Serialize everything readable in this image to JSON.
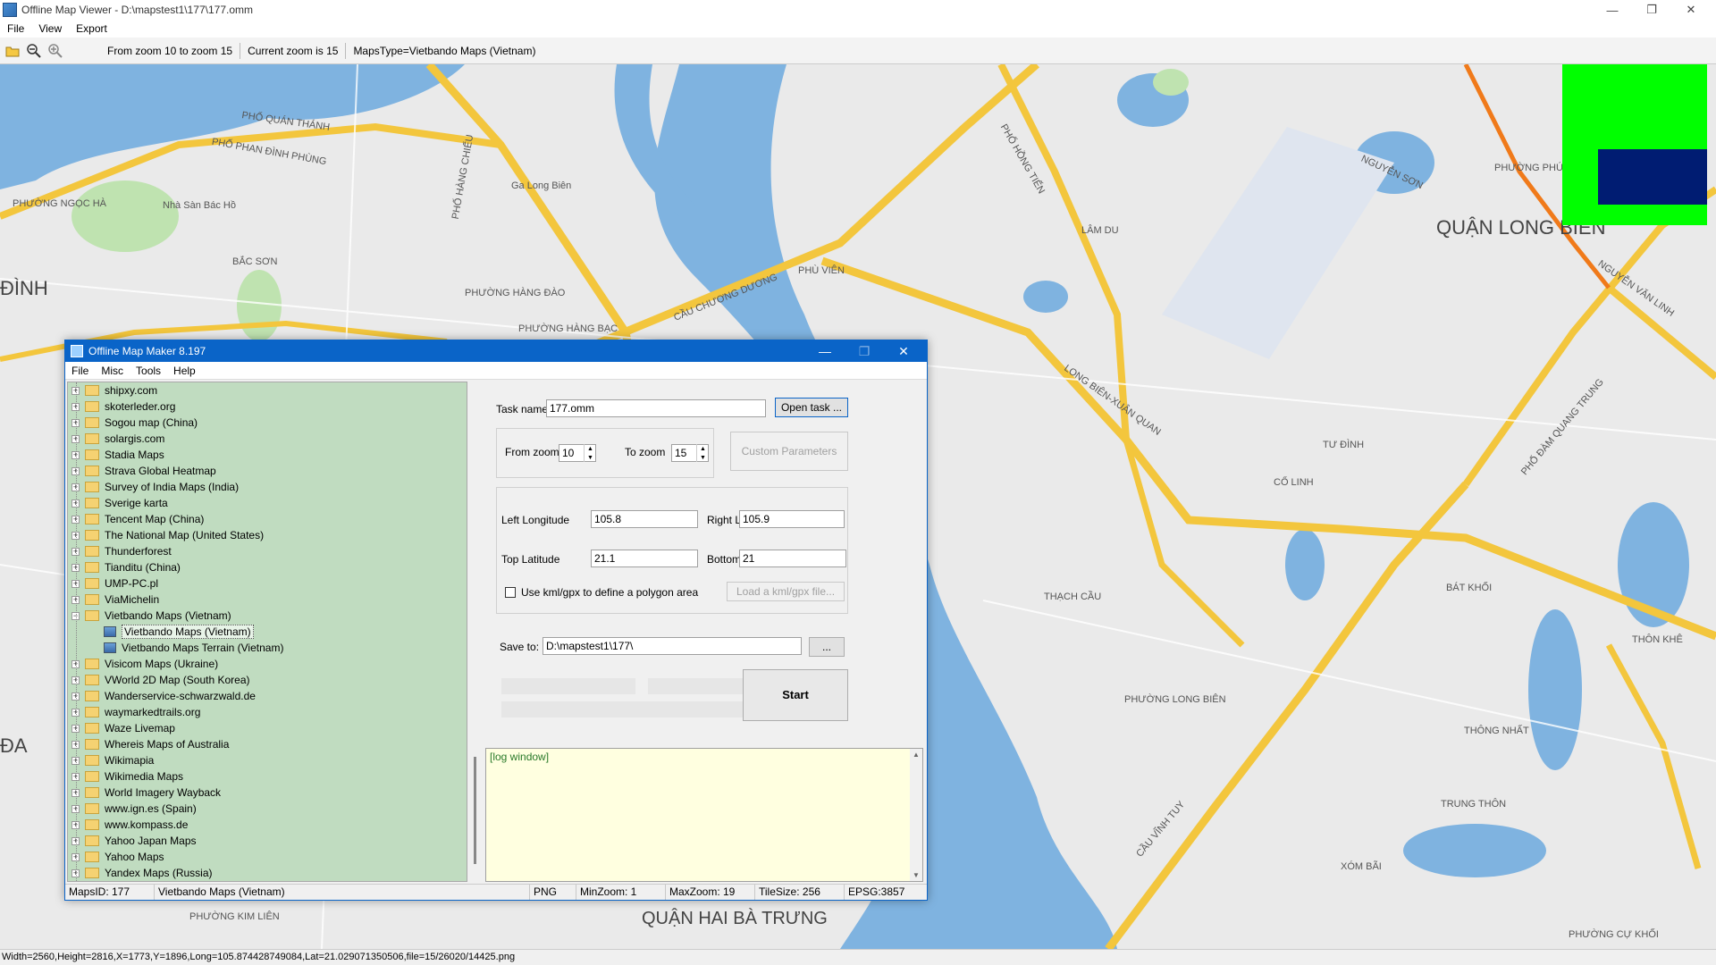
{
  "window": {
    "title": "Offline Map Viewer - D:\\mapstest1\\177\\177.omm",
    "minimize": "—",
    "maximize": "❐",
    "close": "✕"
  },
  "menu": [
    "File",
    "View",
    "Export"
  ],
  "toolbar": {
    "open_icon": "folder-open-icon",
    "zoom_out_icon": "zoom-out-icon",
    "zoom_in_icon": "zoom-in-icon",
    "zoom_range": "From zoom 10 to zoom 15",
    "current_zoom": "Current zoom is 15",
    "maps_type": "MapsType=Vietbando Maps (Vietnam)"
  },
  "map": {
    "labels": [
      "QUẬN LONG BIÊN",
      "ĐÌNH",
      "QUẬN HAI BÀ TRƯNG",
      "ĐA",
      "CẦU CHƯƠNG DƯƠNG",
      "LONG BIÊN-XUÂN QUAN",
      "CỔ LINH",
      "CẦU VĨNH TUY",
      "PHƯỜNG LONG BIÊN",
      "THẠCH CẦU",
      "TRUNG THÔN",
      "XÓM BÃI",
      "THÔNG NHẤT",
      "PHƯỜNG HÀNG ĐÀO",
      "PHỐ PHAN ĐÌNH PHÙNG",
      "PHỐ QUÁN THÁNH",
      "Ga Long Biên",
      "Nhà Sàn Bác Hồ",
      "PHƯỜNG NGỌC HÀ",
      "BẮC SƠN",
      "PHÙ VIÊN",
      "BÁT KHỐI",
      "PHƯỜNG CỰ KHỐI",
      "NGUYỄN VĂN LINH",
      "PHỐ ĐÀM QUANG TRUNG",
      "TƯ ĐÌNH",
      "THÔN KHÊ",
      "PHƯỜNG PHÚC ĐỒNG",
      "NGUYỄN SƠN",
      "PHƯỜNG KIM LIÊN",
      "PHỐ HỒNG TIẾN",
      "LÂM DU",
      "PHỐ HÀNG CHIẾU",
      "PHƯỜNG HÀNG BẠC"
    ],
    "overview_colors": {
      "background": "#00ff00",
      "viewport": "#001c72"
    }
  },
  "status_bar": "Width=2560,Height=2816,X=1773,Y=1896,Long=105.874428749084,Lat=21.029071350506,file=15/26020/14425.png",
  "dialog": {
    "title": "Offline Map Maker 8.197",
    "menu": [
      "File",
      "Misc",
      "Tools",
      "Help"
    ],
    "tree": [
      {
        "label": "shipxy.com",
        "type": "folder"
      },
      {
        "label": "skoterleder.org",
        "type": "folder"
      },
      {
        "label": "Sogou map (China)",
        "type": "folder"
      },
      {
        "label": "solargis.com",
        "type": "folder"
      },
      {
        "label": "Stadia Maps",
        "type": "folder"
      },
      {
        "label": "Strava Global Heatmap",
        "type": "folder"
      },
      {
        "label": "Survey of India Maps (India)",
        "type": "folder"
      },
      {
        "label": "Sverige karta",
        "type": "folder"
      },
      {
        "label": "Tencent Map (China)",
        "type": "folder"
      },
      {
        "label": "The National Map (United States)",
        "type": "folder"
      },
      {
        "label": "Thunderforest",
        "type": "folder"
      },
      {
        "label": "Tianditu (China)",
        "type": "folder"
      },
      {
        "label": "UMP-PC.pl",
        "type": "folder"
      },
      {
        "label": "ViaMichelin",
        "type": "folder"
      },
      {
        "label": "Vietbando Maps (Vietnam)",
        "type": "open-folder"
      },
      {
        "label": "Vietbando Maps (Vietnam)",
        "type": "child-selected"
      },
      {
        "label": "Vietbando Maps Terrain (Vietnam)",
        "type": "child"
      },
      {
        "label": "Visicom Maps (Ukraine)",
        "type": "folder"
      },
      {
        "label": "VWorld 2D Map (South Korea)",
        "type": "folder"
      },
      {
        "label": "Wanderservice-schwarzwald.de",
        "type": "folder"
      },
      {
        "label": "waymarkedtrails.org",
        "type": "folder"
      },
      {
        "label": "Waze Livemap",
        "type": "folder"
      },
      {
        "label": "Whereis Maps of Australia",
        "type": "folder"
      },
      {
        "label": "Wikimapia",
        "type": "folder"
      },
      {
        "label": "Wikimedia Maps",
        "type": "folder"
      },
      {
        "label": "World Imagery Wayback",
        "type": "folder"
      },
      {
        "label": "www.ign.es (Spain)",
        "type": "folder"
      },
      {
        "label": "www.kompass.de",
        "type": "folder"
      },
      {
        "label": "Yahoo Japan Maps",
        "type": "folder"
      },
      {
        "label": "Yahoo Maps",
        "type": "folder"
      },
      {
        "label": "Yandex Maps (Russia)",
        "type": "folder"
      }
    ],
    "form": {
      "task_name_label": "Task name",
      "task_name_value": "177.omm",
      "open_task": "Open task ...",
      "from_zoom_label": "From zoom",
      "from_zoom_value": "10",
      "to_zoom_label": "To zoom",
      "to_zoom_value": "15",
      "custom_params": "Custom Parameters",
      "left_lon_label": "Left Longitude",
      "left_lon_value": "105.8",
      "right_lon_label": "Right Longitude",
      "right_lon_value": "105.9",
      "top_lat_label": "Top Latitude",
      "top_lat_value": "21.1",
      "bottom_lat_label": "Bottom Latitude",
      "bottom_lat_value": "21",
      "kml_label": "Use kml/gpx to define a polygon area",
      "load_kml": "Load a kml/gpx file...",
      "save_to_label": "Save to:",
      "save_to_value": "D:\\mapstest1\\177\\",
      "browse": "...",
      "start": "Start",
      "log": "[log window]"
    },
    "status": {
      "maps_id": "MapsID: 177",
      "maps_name": "Vietbando Maps (Vietnam)",
      "format": "PNG",
      "min_zoom": "MinZoom: 1",
      "max_zoom": "MaxZoom: 19",
      "tile_size": "TileSize: 256",
      "epsg": "EPSG:3857"
    }
  }
}
